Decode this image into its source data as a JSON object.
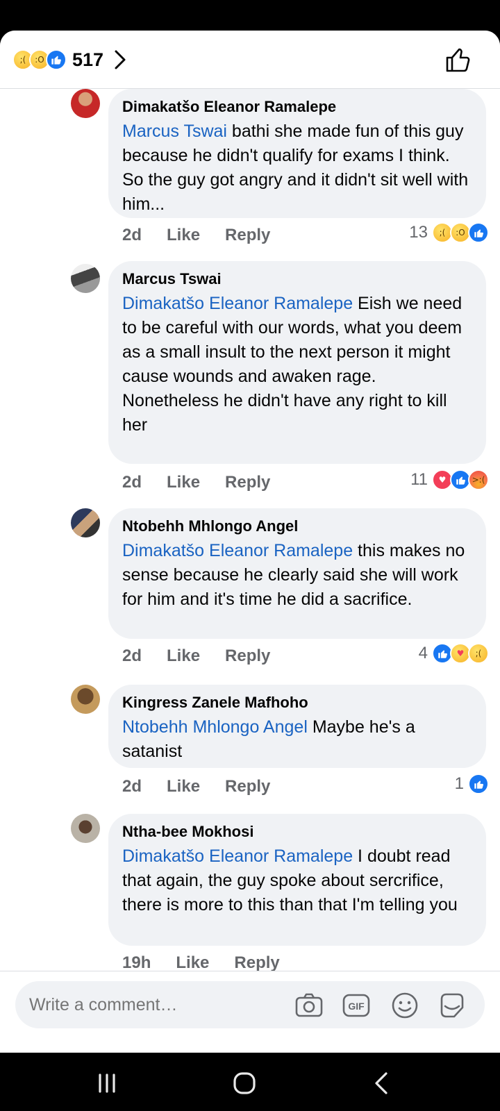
{
  "header": {
    "reaction_icons": [
      "sad-icon",
      "wow-icon",
      "like-icon"
    ],
    "reaction_count": "517"
  },
  "comments": [
    {
      "author": "Dimakatšo Eleanor Ramalepe",
      "mention": "Marcus Tswai",
      "text": "  bathi she made fun of this guy because he didn't qualify for exams I think. So the guy got angry and it didn't sit well with him...",
      "time": "2d",
      "like_label": "Like",
      "reply_label": "Reply",
      "reaction_count": "13",
      "reactions": [
        "sad-icon",
        "wow-icon",
        "like-icon"
      ]
    },
    {
      "author": "Marcus Tswai",
      "mention": "Dimakatšo Eleanor Ramalepe",
      "text": "  Eish we need to be careful with our words, what you deem as a small insult to the next person it might cause wounds and awaken rage.\nNonetheless he didn't have any right to kill her",
      "time": "2d",
      "like_label": "Like",
      "reply_label": "Reply",
      "reaction_count": "11",
      "reactions": [
        "love-icon",
        "like-icon",
        "angry-icon"
      ]
    },
    {
      "author": "Ntobehh Mhlongo Angel",
      "mention": "Dimakatšo Eleanor Ramalepe",
      "text": " this makes no sense because he clearly said she will work for him and it's time he did a sacrifice.",
      "time": "2d",
      "like_label": "Like",
      "reply_label": "Reply",
      "reaction_count": "4",
      "reactions": [
        "like-icon",
        "care-icon",
        "sad-icon"
      ]
    },
    {
      "author": "Kingress Zanele Mafhoho",
      "mention": "Ntobehh Mhlongo Angel",
      "text": " Maybe he's a satanist",
      "time": "2d",
      "like_label": "Like",
      "reply_label": "Reply",
      "reaction_count": "1",
      "reactions": [
        "like-icon"
      ]
    },
    {
      "author": "Ntha-bee Mokhosi",
      "mention": "Dimakatšo Eleanor Ramalepe",
      "text": " I doubt read that again,  the guy spoke about sercrifice,  there is more to this than that I'm telling you",
      "time": "19h",
      "like_label": "Like",
      "reply_label": "Reply",
      "reaction_count": "",
      "reactions": []
    }
  ],
  "composer": {
    "placeholder": "Write a comment…",
    "icons": [
      "camera-icon",
      "gif-icon",
      "emoji-icon",
      "sticker-icon"
    ]
  },
  "system_nav": {
    "icons": [
      "recent-apps-icon",
      "home-icon",
      "back-icon"
    ]
  },
  "colors": {
    "mention": "#1a63c2",
    "bubble": "#f0f2f5",
    "like_blue": "#1877f2",
    "love_red": "#f33e58",
    "meta_gray": "#65676b"
  }
}
